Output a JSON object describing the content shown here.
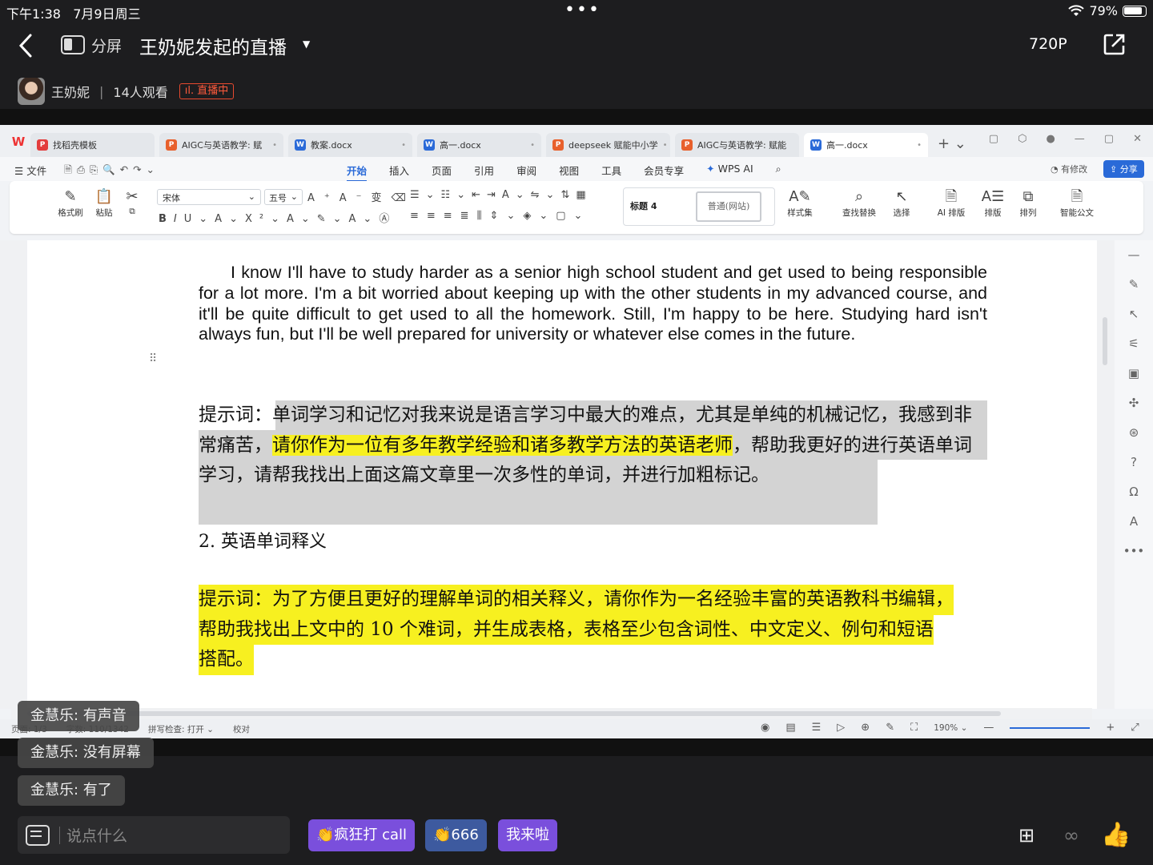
{
  "status_bar": {
    "time": "下午1:38",
    "date": "7月9日周三",
    "battery": "79%"
  },
  "header": {
    "split_label": "分屏",
    "title": "王奶妮发起的直播",
    "quality": "720P",
    "host_name": "王奶妮",
    "viewers": "14人观看",
    "live_status": "直播中"
  },
  "wps": {
    "tabs": [
      {
        "label": "找稻壳模板",
        "type": "r"
      },
      {
        "label": "AIGC与英语教学: 赋",
        "type": "p"
      },
      {
        "label": "教案.docx",
        "type": "w"
      },
      {
        "label": "高一.docx",
        "type": "w"
      },
      {
        "label": "deepseek 赋能中小学",
        "type": "p"
      },
      {
        "label": "AIGC与英语教学: 赋能",
        "type": "p"
      },
      {
        "label": "高一.docx",
        "type": "w"
      }
    ],
    "menu": {
      "file": "文件",
      "items": [
        "开始",
        "插入",
        "页面",
        "引用",
        "审阅",
        "视图",
        "工具",
        "会员专享",
        "WPS AI"
      ],
      "modify": "有修改",
      "share": "分享"
    },
    "ribbon": {
      "format_painter": "格式刷",
      "paste": "粘贴",
      "font": "宋体",
      "size": "五号",
      "style_h4": "标题 4",
      "style_normal": "普通(网站)",
      "style_set": "样式集",
      "find_replace": "查找替换",
      "select": "选择",
      "ai_layout": "AI 排版",
      "layout": "排版",
      "arrange": "排列",
      "smart_doc": "智能公文"
    },
    "doc": {
      "english_paragraph": "I know I'll have to study harder as a senior high school student and get used to being responsible for a lot more. I'm a bit worried about keeping up with the other students in my advanced course, and it'll be quite difficult to get used to all the homework. Still, I'm happy to be here. Studying hard isn't always fun, but I'll be well prepared for university or whatever else comes in the future.",
      "prompt1_label": "提示词：",
      "prompt1_part1": "单词学习和记忆对我来说是语言学习中最大的难点，尤其是单纯的机械记忆，我感到非常痛苦，",
      "prompt1_highlight": "请你作为一位有多年教学经验和诸多教学方法的英语老师",
      "prompt1_part2": "，帮助我更好的进行英语单词学习，请帮我找出上面这篇文章里一次多性的单词，并进行加粗标记。",
      "heading": "2.  英语单词释义",
      "prompt2_line1": "提示词：为了方便且更好的理解单词的相关释义，请你作为一名经验丰富的英语教科书编辑，",
      "prompt2_line2": "帮助我找出上文中的 10 个难词，并生成表格，表格至少包含词性、中文定义、例句和短语",
      "prompt2_line3": "搭配。"
    },
    "statusline": {
      "page": "页面: 1/3",
      "words": "字数: 110/1342",
      "spell": "拼写检查: 打开",
      "proof": "校对",
      "zoom": "190%"
    }
  },
  "comments": [
    {
      "user": "金慧乐",
      "text": "有声音"
    },
    {
      "user": "金慧乐",
      "text": "没有屏幕"
    },
    {
      "user": "金慧乐",
      "text": "有了"
    }
  ],
  "bottom_bar": {
    "input_placeholder": "说点什么",
    "quick1": "👏疯狂打 call",
    "quick2": "👏666",
    "quick3": "我来啦"
  },
  "colors": {
    "highlight": "#f7f020",
    "gray_highlight": "#d3d3d3",
    "live_red": "#e84a2f",
    "wps_blue": "#2a6ad8",
    "quick_purple": "#7a4fdc"
  }
}
